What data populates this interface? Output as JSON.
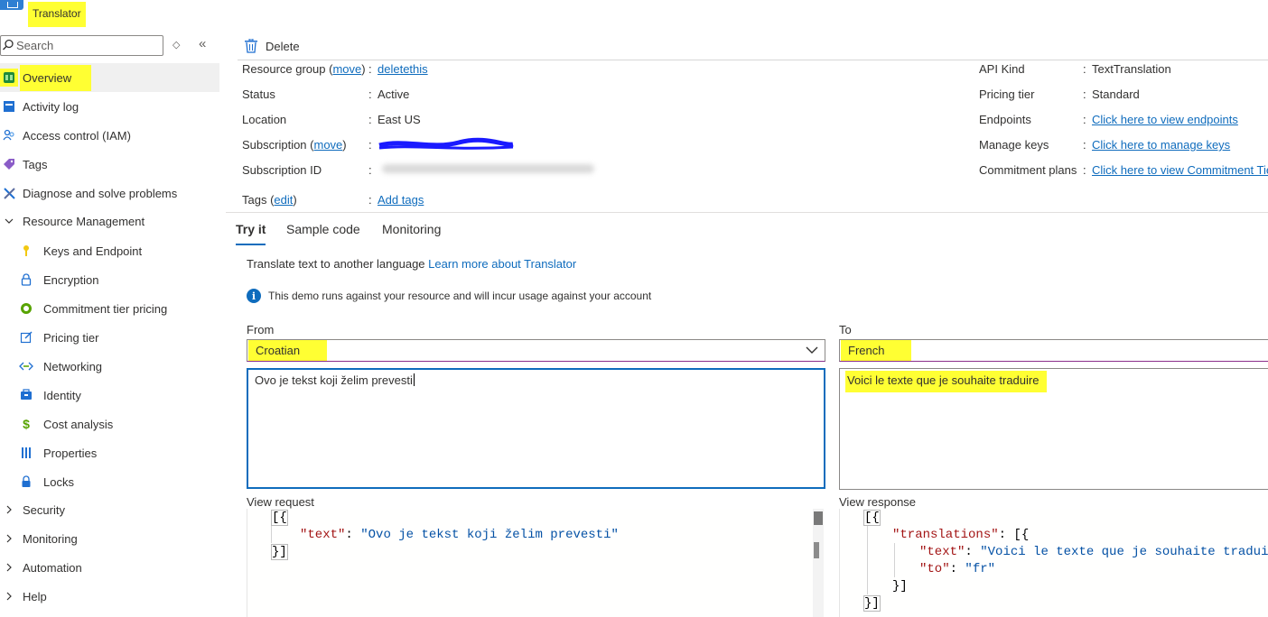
{
  "app": {
    "title": "Translator"
  },
  "sidebar": {
    "search_placeholder": "Search",
    "items": [
      {
        "label": "Overview",
        "icon": "overview-icon",
        "selected": true
      },
      {
        "label": "Activity log",
        "icon": "activity-log-icon"
      },
      {
        "label": "Access control (IAM)",
        "icon": "people-icon"
      },
      {
        "label": "Tags",
        "icon": "tag-icon"
      },
      {
        "label": "Diagnose and solve problems",
        "icon": "wrench-icon"
      },
      {
        "label": "Resource Management",
        "icon": "chevron-down-icon",
        "expanded": true
      },
      {
        "label": "Keys and Endpoint",
        "icon": "key-icon"
      },
      {
        "label": "Encryption",
        "icon": "lock-icon"
      },
      {
        "label": "Commitment tier pricing",
        "icon": "commitment-icon"
      },
      {
        "label": "Pricing tier",
        "icon": "pricing-tier-icon"
      },
      {
        "label": "Networking",
        "icon": "networking-icon"
      },
      {
        "label": "Identity",
        "icon": "identity-icon"
      },
      {
        "label": "Cost analysis",
        "icon": "cost-analysis-icon"
      },
      {
        "label": "Properties",
        "icon": "properties-icon"
      },
      {
        "label": "Locks",
        "icon": "lock-icon"
      },
      {
        "label": "Security",
        "icon": "chevron-right-icon"
      },
      {
        "label": "Monitoring",
        "icon": "chevron-right-icon"
      },
      {
        "label": "Automation",
        "icon": "chevron-right-icon"
      },
      {
        "label": "Help",
        "icon": "chevron-right-icon"
      }
    ]
  },
  "toolbar": {
    "delete_label": "Delete"
  },
  "essentials": {
    "left": {
      "resource_group": {
        "label": "Resource group",
        "move": "move",
        "value": "deletethis"
      },
      "status": {
        "label": "Status",
        "value": "Active"
      },
      "location": {
        "label": "Location",
        "value": "East US"
      },
      "subscription": {
        "label": "Subscription",
        "move": "move"
      },
      "subscription_id": {
        "label": "Subscription ID"
      },
      "tags": {
        "label": "Tags",
        "edit": "edit",
        "value": "Add tags"
      }
    },
    "right": {
      "api_kind": {
        "label": "API Kind",
        "value": "TextTranslation"
      },
      "pricing_tier": {
        "label": "Pricing tier",
        "value": "Standard"
      },
      "endpoints": {
        "label": "Endpoints",
        "value": "Click here to view endpoints"
      },
      "manage_keys": {
        "label": "Manage keys",
        "value": "Click here to manage keys"
      },
      "commitment_plans": {
        "label": "Commitment plans",
        "value": "Click here to view Commitment Tie"
      }
    }
  },
  "tabs": [
    {
      "label": "Try it",
      "active": true
    },
    {
      "label": "Sample code"
    },
    {
      "label": "Monitoring"
    }
  ],
  "try_it": {
    "intro": "Translate text to another language",
    "learn_more": "Learn more about Translator",
    "info": "This demo runs against your resource and will incur usage against your account",
    "from_label": "From",
    "to_label": "To",
    "from_language": "Croatian",
    "to_language": "French",
    "source_text": "Ovo je tekst koji želim prevesti",
    "translated_text": "Voici le texte que je souhaite traduire",
    "view_request_label": "View request",
    "view_response_label": "View response"
  },
  "request_code": {
    "l1": "[{",
    "key": "\"text\"",
    "sep": ": ",
    "val": "\"Ovo je tekst koji želim prevesti\"",
    "l3": "}]"
  },
  "response_code": {
    "l1": "[{",
    "tr_key": "\"translations\"",
    "tr_open": ": [{",
    "text_key": "\"text\"",
    "text_sep": ": ",
    "text_val": "\"Voici le texte que je souhaite traduire\"",
    "comma": ",",
    "to_key": "\"to\"",
    "to_sep": ": ",
    "to_val": "\"fr\"",
    "l5": "}]",
    "l6": "}]"
  },
  "colors": {
    "highlight": "#ffff33",
    "link": "#0f6cbd",
    "focus_border": "#0f6cbd"
  }
}
